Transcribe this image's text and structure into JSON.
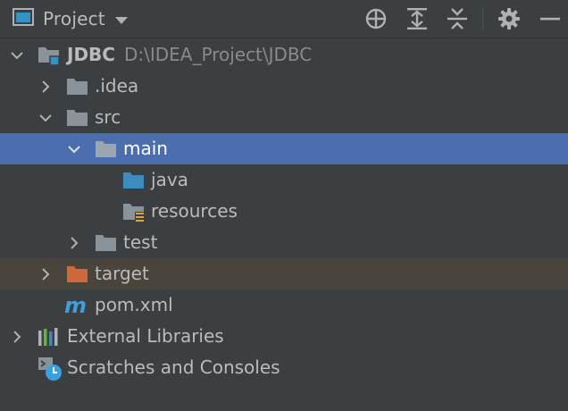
{
  "toolbar": {
    "title": "Project",
    "buttons": [
      {
        "name": "locate-icon"
      },
      {
        "name": "expand-all-icon"
      },
      {
        "name": "collapse-all-icon"
      },
      {
        "name": "gear-icon"
      },
      {
        "name": "hide-icon"
      }
    ]
  },
  "tree": {
    "root": {
      "name": "JDBC",
      "path": "D:\\IDEA_Project\\JDBC"
    },
    "idea": "idea",
    "idea_prefix": ".",
    "src": "src",
    "main": "main",
    "java": "java",
    "resources": "resources",
    "test": "test",
    "target": "target",
    "pom": "pom.xml",
    "external_libraries": "External Libraries",
    "scratches": "Scratches and Consoles"
  },
  "colors": {
    "selection": "#4b6eaf",
    "excluded_row": "#4a453c",
    "folder": "#8a9399",
    "source_folder": "#3d8cbd",
    "excluded_folder": "#d0683a",
    "maven": "#3aa0e0"
  }
}
